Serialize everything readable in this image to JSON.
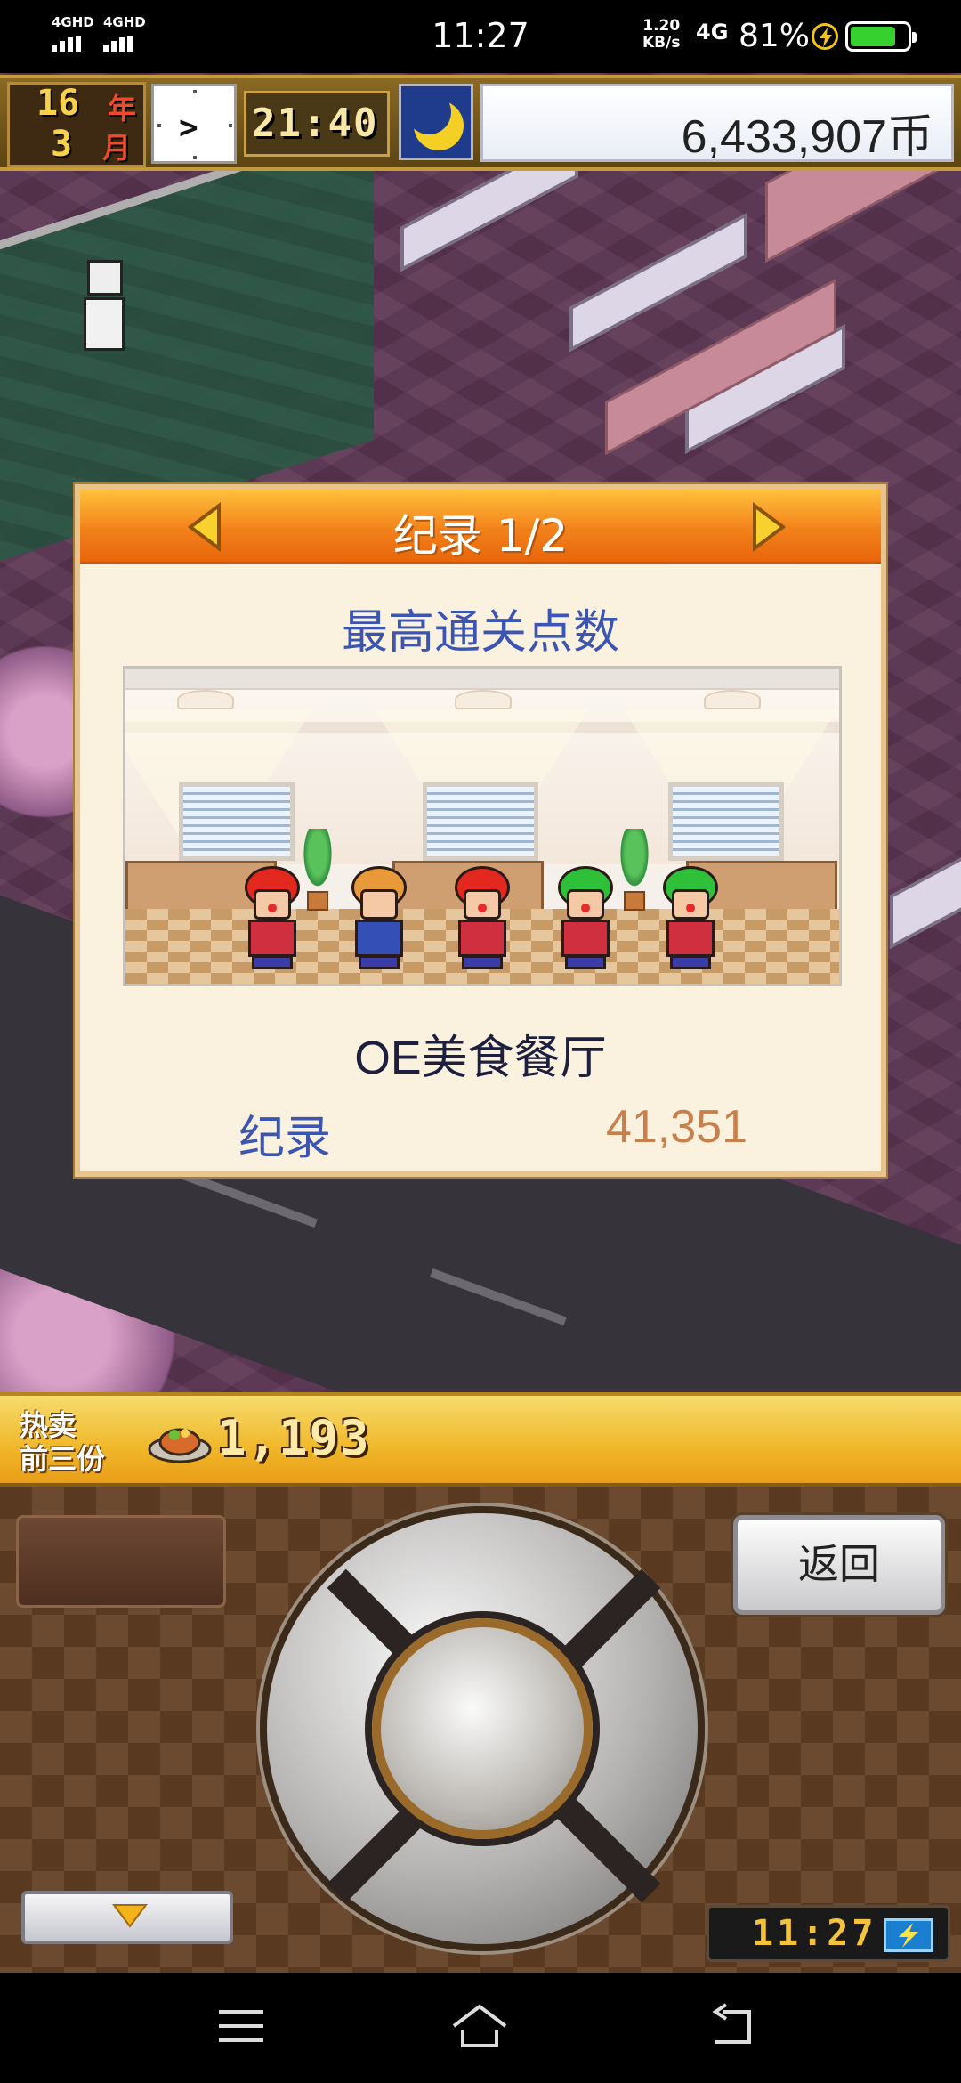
{
  "status_bar": {
    "time": "11:27",
    "net1": "4GHD",
    "net2": "4GHD",
    "speed_value": "1.20",
    "speed_unit": "KB/s",
    "net_type": "4G",
    "battery": "81%",
    "battery_level": 0.81
  },
  "hud": {
    "year": "16",
    "year_unit": "年",
    "month": "3",
    "month_unit": "月",
    "clock_hand": ">",
    "game_time": "21:40",
    "money": "6,433,907币"
  },
  "dialog": {
    "title": "纪录 1/2",
    "subtitle": "最高通关点数",
    "restaurant_name": "OE美食餐厅",
    "record_label": "纪录",
    "record_value": "41,351"
  },
  "bestseller": {
    "label_line1": "热卖",
    "label_line2": "前三份",
    "count": "1,193"
  },
  "controller": {
    "back_label": "返回",
    "clock": "11:27"
  },
  "colors": {
    "header_orange": "#f3821b",
    "subtitle_blue": "#3b56b2",
    "record_value_color": "#c77f4b",
    "dialog_bg": "#fbf1df"
  },
  "icons": {
    "prev": "triangle-left-icon",
    "next": "triangle-right-icon",
    "time_of_day": "moon-icon",
    "menu": "menu-lines-icon",
    "home": "home-icon",
    "back": "back-arrow-icon"
  }
}
